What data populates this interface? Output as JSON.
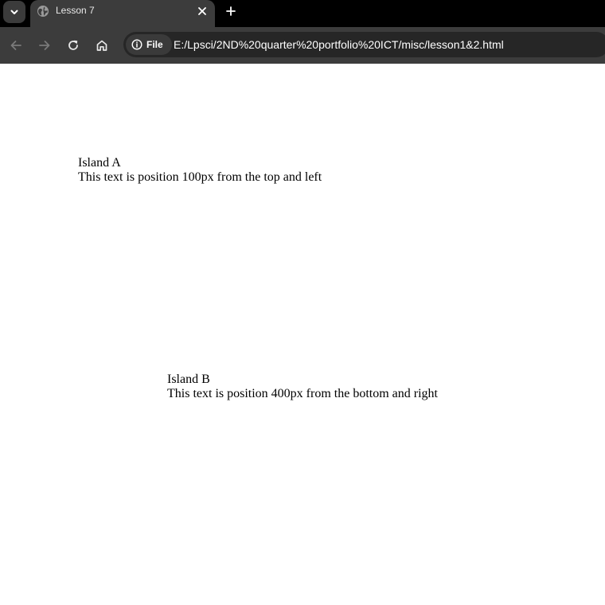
{
  "browser": {
    "tab": {
      "title": "Lesson 7",
      "favicon": "globe-icon"
    },
    "toolbar": {
      "site_chip_label": "File",
      "url": "E:/Lpsci/2ND%20quarter%20portfolio%20ICT/misc/lesson1&2.html"
    },
    "colors": {
      "tabstrip": "#000000",
      "toolbar": "#3c3c3c",
      "omnibox": "#262626",
      "disabled_icon": "#7a7a7a",
      "icon": "#e8e8e8"
    }
  },
  "page": {
    "island_a": {
      "heading": "Island A",
      "text": "This text is position 100px from the top and left"
    },
    "island_b": {
      "heading": "Island B",
      "text": "This text is position 400px from the bottom and right"
    }
  }
}
